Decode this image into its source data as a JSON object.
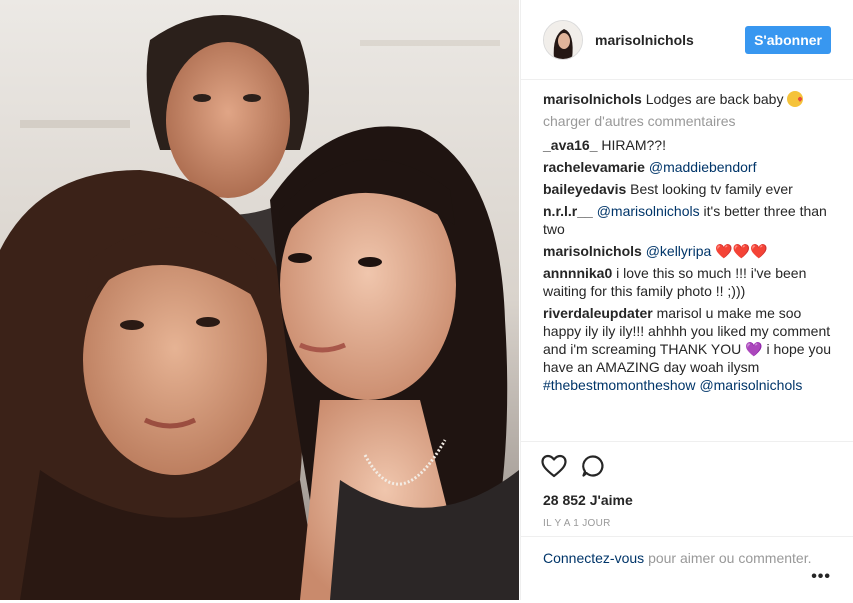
{
  "post": {
    "username": "marisolnichols",
    "follow_label": "S'abonner"
  },
  "caption": {
    "author": "marisolnichols",
    "text": "Lodges are back baby"
  },
  "load_more": "charger d'autres commentaires",
  "comments": [
    {
      "author": "_ava16_",
      "text": "HIRAM??!"
    },
    {
      "author": "rachelevamarie",
      "mention": "@maddiebendorf"
    },
    {
      "author": "baileyedavis",
      "text": "Best looking tv family ever"
    },
    {
      "author": "n.r.l.r__",
      "mention": "@marisolnichols",
      "text": "it's better three than two"
    },
    {
      "author": "marisolnichols",
      "mention": "@kellyripa",
      "hearts": "❤️❤️❤️"
    },
    {
      "author": "annnnika0",
      "text": "i love this so much !!! i've been waiting for this family photo !! ;)))"
    },
    {
      "author": "riverdaleupdater",
      "text1": "marisol u make me soo happy ily ily ily!!! ahhhh you liked my comment and i'm screaming THANK YOU",
      "heart": "💜",
      "text2": "i hope you have an AMAZING day woah ilysm",
      "hashtag": "#thebestmomontheshow",
      "mention": "@marisolnichols"
    }
  ],
  "likes": "28 852 J'aime",
  "time": "IL Y A 1 JOUR",
  "login": {
    "link": "Connectez-vous",
    "text": "pour aimer ou commenter."
  },
  "more_label": "•••",
  "icons": [
    "heart-outline-icon",
    "comment-bubble-icon",
    "ellipsis-icon"
  ],
  "colors": {
    "accent": "#3897f0",
    "link": "#003569",
    "muted": "#999999"
  }
}
